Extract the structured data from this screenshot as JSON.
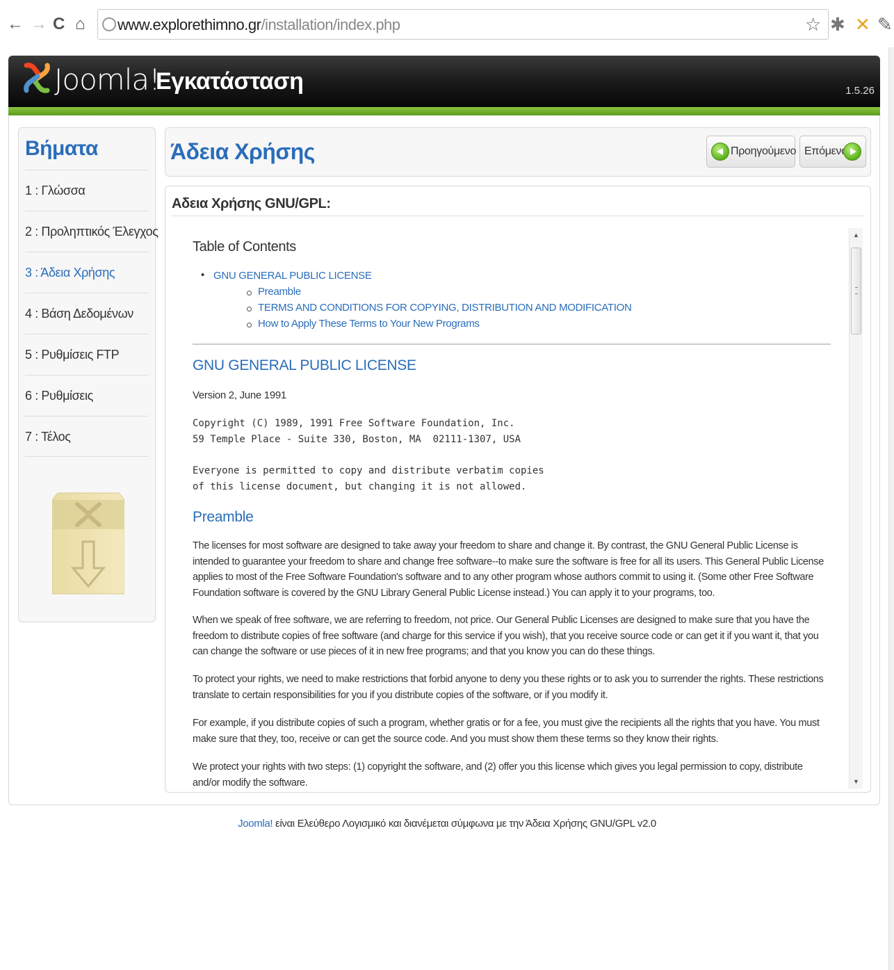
{
  "browser": {
    "url_host": "www.explorethimno.gr",
    "url_path": "/installation/index.php",
    "icons": [
      "back-arrow-icon",
      "forward-arrow-icon",
      "reload-icon",
      "home-icon",
      "globe-icon",
      "star-icon",
      "extension-icon",
      "joomla-extension-icon",
      "wrench-icon"
    ]
  },
  "header": {
    "logo_text": "Joomla!",
    "title": "Εγκατάσταση",
    "version": "1.5.26"
  },
  "steps": {
    "title": "Βήματα",
    "items": [
      {
        "label": "1 : Γλώσσα"
      },
      {
        "label": "2 : Προληπτικός Έλεγχος"
      },
      {
        "label": "3 : Άδεια Χρήσης"
      },
      {
        "label": "4 : Βάση Δεδομένων"
      },
      {
        "label": "5 : Ρυθμίσεις FTP"
      },
      {
        "label": "6 : Ρυθμίσεις"
      },
      {
        "label": "7 : Τέλος"
      }
    ],
    "active_index": 2
  },
  "main": {
    "title": "Άδεια Χρήσης",
    "prev_label": "Προηγούμενο",
    "next_label": "Επόμενο"
  },
  "license": {
    "heading": "Αδεια Χρήσης GNU/GPL:",
    "toc_title": "Table of Contents",
    "toc_main": "GNU GENERAL PUBLIC LICENSE",
    "toc_sub": [
      "Preamble",
      "TERMS AND CONDITIONS FOR COPYING, DISTRIBUTION AND MODIFICATION",
      "How to Apply These Terms to Your New Programs"
    ],
    "gpl_heading": "GNU GENERAL PUBLIC LICENSE",
    "version_line": "Version 2, June 1991",
    "copyright_1": "Copyright (C) 1989, 1991 Free Software Foundation, Inc.",
    "copyright_2": "59 Temple Place - Suite 330, Boston, MA  02111-1307, USA",
    "everyone_1": "Everyone is permitted to copy and distribute verbatim copies",
    "everyone_2": "of this license document, but changing it is not allowed.",
    "preamble_heading": "Preamble",
    "paragraphs": [
      "The licenses for most software are designed to take away your freedom to share and change it. By contrast, the GNU General Public License is intended to guarantee your freedom to share and change free software--to make sure the software is free for all its users. This General Public License applies to most of the Free Software Foundation's software and to any other program whose authors commit to using it. (Some other Free Software Foundation software is covered by the GNU Library General Public License instead.) You can apply it to your programs, too.",
      "When we speak of free software, we are referring to freedom, not price. Our General Public Licenses are designed to make sure that you have the freedom to distribute copies of free software (and charge for this service if you wish), that you receive source code or can get it if you want it, that you can change the software or use pieces of it in new free programs; and that you know you can do these things.",
      "To protect your rights, we need to make restrictions that forbid anyone to deny you these rights or to ask you to surrender the rights. These restrictions translate to certain responsibilities for you if you distribute copies of the software, or if you modify it.",
      "For example, if you distribute copies of such a program, whether gratis or for a fee, you must give the recipients all the rights that you have. You must make sure that they, too, receive or can get the source code. And you must show them these terms so they know their rights.",
      "We protect your rights with two steps: (1) copyright the software, and (2) offer you this license which gives you legal permission to copy, distribute and/or modify the software."
    ]
  },
  "footer": {
    "link": "Joomla!",
    "text": " είναι Ελεύθερο Λογισμικό και διανέμεται σύμφωνα με την Άδεια Χρήσης GNU/GPL v2.0"
  }
}
